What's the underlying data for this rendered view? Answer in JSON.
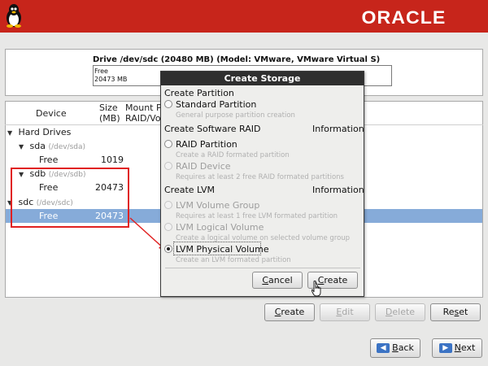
{
  "banner": {
    "logo": "ORACLE",
    "icon": "tux-penguin-icon",
    "color": "#c7251b"
  },
  "drive": {
    "title": "Drive /dev/sdc (20480 MB) (Model: VMware, VMware Virtual S)",
    "segment_label_1": "Free",
    "segment_label_2": "20473 MB"
  },
  "table": {
    "headers": {
      "device": "Device",
      "size_1": "Size",
      "size_2": "(MB)",
      "mount_1": "Mount Po",
      "mount_2": "RAID/Volu"
    },
    "rows": [
      {
        "label": "Hard Drives",
        "size": "",
        "path": ""
      },
      {
        "label": "sda",
        "size": "",
        "path": "(/dev/sda)"
      },
      {
        "label": "Free",
        "size": "1019",
        "path": ""
      },
      {
        "label": "sdb",
        "size": "",
        "path": "(/dev/sdb)"
      },
      {
        "label": "Free",
        "size": "20473",
        "path": ""
      },
      {
        "label": "sdc",
        "size": "",
        "path": "(/dev/sdc)"
      },
      {
        "label": "Free",
        "size": "20473",
        "path": ""
      }
    ],
    "selection_color": "#86abd9"
  },
  "dialog": {
    "title": "Create Storage",
    "section_partition": "Create Partition",
    "standard_partition": "Standard Partition",
    "standard_partition_desc": "General purpose partition creation",
    "section_raid": "Create Software RAID",
    "raid_info": "Information",
    "raid_partition": "RAID Partition",
    "raid_partition_desc": "Create a RAID formated partition",
    "raid_device": "RAID Device",
    "raid_device_desc": "Requires at least 2 free RAID formated partitions",
    "section_lvm": "Create LVM",
    "lvm_info": "Information",
    "lvm_group": "LVM Volume Group",
    "lvm_group_desc": "Requires at least 1 free LVM formated partition",
    "lvm_logical": "LVM Logical Volume",
    "lvm_logical_desc": "Create a logical volume on selected volume group",
    "lvm_physical": "LVM Physical Volume",
    "lvm_physical_desc": "Create an LVM formated partition",
    "cancel_pre": "",
    "cancel_key": "C",
    "cancel_post": "ancel",
    "create_pre": "",
    "create_key": "C",
    "create_post": "reate"
  },
  "actions": {
    "create_key": "C",
    "create_post": "reate",
    "edit_key": "E",
    "edit_post": "dit",
    "delete_key": "D",
    "delete_post": "elete",
    "reset_pre": "Re",
    "reset_key": "s",
    "reset_post": "et"
  },
  "nav": {
    "back_key": "B",
    "back_post": "ack",
    "next_key": "N",
    "next_post": "ext"
  },
  "annotation": {
    "color": "#e02020"
  }
}
